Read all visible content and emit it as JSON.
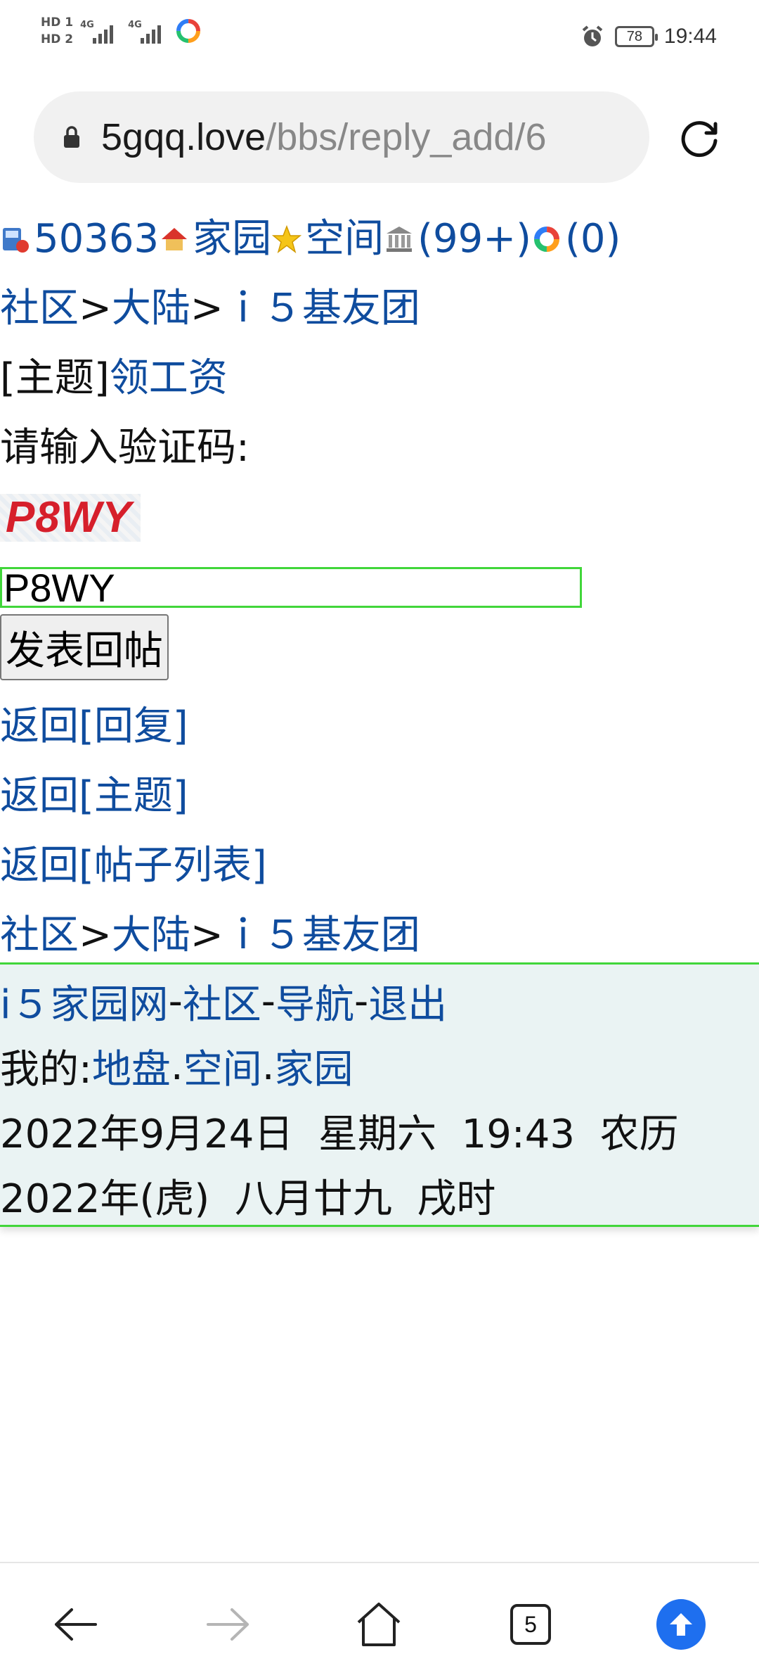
{
  "status_bar": {
    "sim1": "HD 1",
    "sim2": "HD 2",
    "net1": "4G",
    "net2": "4G",
    "battery": "78",
    "time": "19:44"
  },
  "address_bar": {
    "host": "5gqq.love",
    "path": "/bbs/reply_add/6"
  },
  "user_bar": {
    "user_id": "50363",
    "home_link": "家园",
    "space_link": "空间",
    "messages_count": "(99+)",
    "notify_count": "(0)"
  },
  "breadcrumb": {
    "community": "社区",
    "sep1": ">",
    "region": "大陆",
    "sep2": ">",
    "group": "ｉ５基友团"
  },
  "topic": {
    "prefix": "[主题]",
    "title": "领工资"
  },
  "captcha": {
    "prompt": "请输入验证码:",
    "image_text": "P8WY",
    "input_value": "P8WY",
    "submit_label": "发表回帖"
  },
  "nav_links": [
    "返回[回复]",
    "返回[主题]",
    "返回[帖子列表]"
  ],
  "footer": {
    "site": "i５家园网",
    "dash": "-",
    "community": "社区",
    "navigation": "导航",
    "logout": "退出",
    "mine_label": "我的:",
    "land": "地盘",
    "dot": ".",
    "space": "空间",
    "home": "家园",
    "date_line1": "2022年9月24日  星期六  19:43  农历",
    "date_line2": "2022年(虎)  八月廿九  戌时"
  },
  "bottom_nav": {
    "tabs_count": "5"
  },
  "colors": {
    "link": "#0f4c9e",
    "accent_green": "#41d63a",
    "footer_bg": "#eaf3f3",
    "up_button": "#1e6fef",
    "captcha_red": "#d61f2b"
  }
}
